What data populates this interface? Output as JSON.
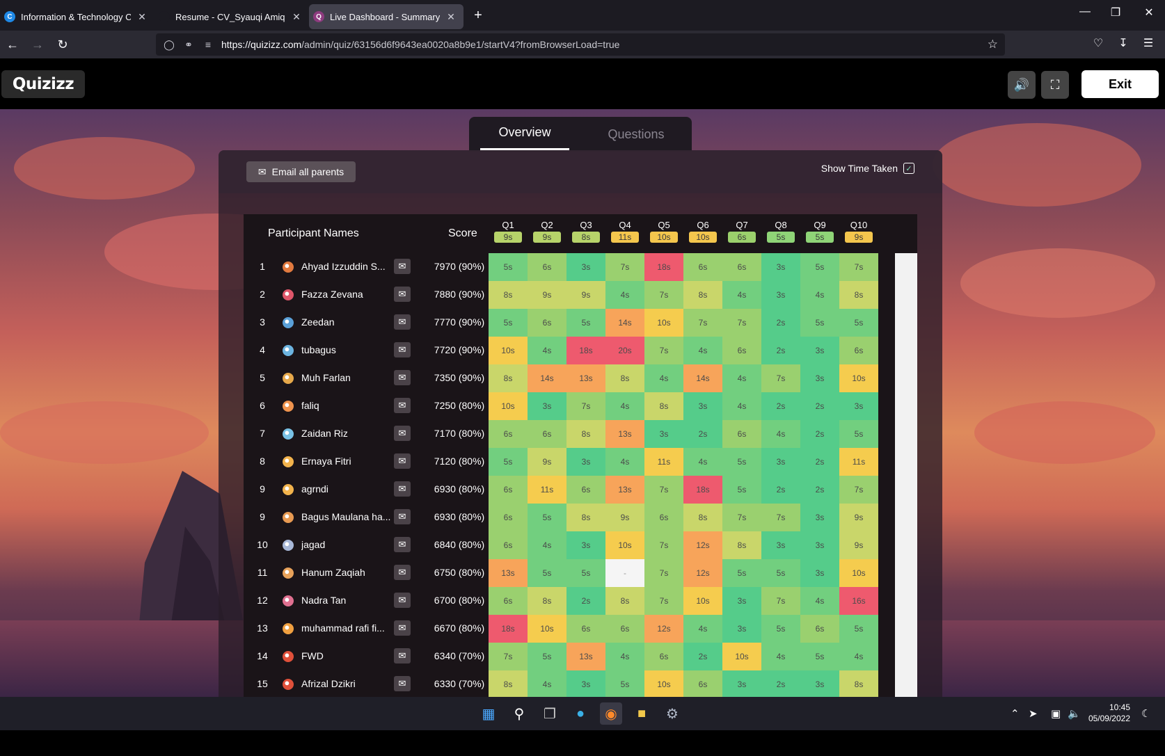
{
  "browser": {
    "tabs": [
      {
        "label": "Information & Technology Chal",
        "favicon": "C",
        "favicon_color": "#1e88e5",
        "active": false
      },
      {
        "label": "Resume - CV_Syauqi Amiq.pdf",
        "favicon": "",
        "favicon_color": "#1c1b22",
        "active": false
      },
      {
        "label": "Live Dashboard - Summary",
        "favicon": "Q",
        "favicon_color": "#8e3b7f",
        "active": true
      }
    ],
    "new_tab": "+",
    "url_domain": "https://quizizz.com",
    "url_path": "/admin/quiz/63156d6f9643ea0020a8b9e1/startV4?fromBrowserLoad=true"
  },
  "header": {
    "logo": "Quizizz",
    "exit_label": "Exit"
  },
  "view_tabs": {
    "overview": "Overview",
    "questions": "Questions"
  },
  "toolbar": {
    "email_all": "Email all parents",
    "show_time": "Show Time Taken",
    "show_time_checked": true
  },
  "table": {
    "col_names": "Participant Names",
    "col_score": "Score",
    "questions": [
      {
        "label": "Q1",
        "avg": "9s",
        "color": "#b7d36a"
      },
      {
        "label": "Q2",
        "avg": "9s",
        "color": "#b7d36a"
      },
      {
        "label": "Q3",
        "avg": "8s",
        "color": "#b7d36a"
      },
      {
        "label": "Q4",
        "avg": "11s",
        "color": "#f4c64d"
      },
      {
        "label": "Q5",
        "avg": "10s",
        "color": "#f4c64d"
      },
      {
        "label": "Q6",
        "avg": "10s",
        "color": "#f4c64d"
      },
      {
        "label": "Q7",
        "avg": "6s",
        "color": "#9bd06c"
      },
      {
        "label": "Q8",
        "avg": "5s",
        "color": "#8fd477"
      },
      {
        "label": "Q9",
        "avg": "5s",
        "color": "#8fd477"
      },
      {
        "label": "Q10",
        "avg": "9s",
        "color": "#f4c64d"
      }
    ],
    "rows": [
      {
        "rank": "1",
        "name": "Ahyad Izzuddin S...",
        "score": "7970 (90%)",
        "avatar": "#e27a3f",
        "times": [
          "5s",
          "6s",
          "3s",
          "7s",
          "18s",
          "6s",
          "6s",
          "3s",
          "5s",
          "7s"
        ]
      },
      {
        "rank": "2",
        "name": "Fazza Zevana",
        "score": "7880 (90%)",
        "avatar": "#e0566a",
        "times": [
          "8s",
          "9s",
          "9s",
          "4s",
          "7s",
          "8s",
          "4s",
          "3s",
          "4s",
          "8s"
        ]
      },
      {
        "rank": "3",
        "name": "Zeedan",
        "score": "7770 (90%)",
        "avatar": "#5aa0d8",
        "times": [
          "5s",
          "6s",
          "5s",
          "14s",
          "10s",
          "7s",
          "7s",
          "2s",
          "5s",
          "5s"
        ]
      },
      {
        "rank": "4",
        "name": "tubagus",
        "score": "7720 (90%)",
        "avatar": "#6cb4e0",
        "times": [
          "10s",
          "4s",
          "18s",
          "20s",
          "7s",
          "4s",
          "6s",
          "2s",
          "3s",
          "6s"
        ]
      },
      {
        "rank": "5",
        "name": "Muh Farlan",
        "score": "7350 (90%)",
        "avatar": "#e6a84a",
        "times": [
          "8s",
          "14s",
          "13s",
          "8s",
          "4s",
          "14s",
          "4s",
          "7s",
          "3s",
          "10s"
        ]
      },
      {
        "rank": "6",
        "name": "faliq",
        "score": "7250 (80%)",
        "avatar": "#f0944e",
        "times": [
          "10s",
          "3s",
          "7s",
          "4s",
          "8s",
          "3s",
          "4s",
          "2s",
          "2s",
          "3s"
        ]
      },
      {
        "rank": "7",
        "name": "Zaidan Riz",
        "score": "7170 (80%)",
        "avatar": "#79c2e6",
        "times": [
          "6s",
          "6s",
          "8s",
          "13s",
          "3s",
          "2s",
          "6s",
          "4s",
          "2s",
          "5s"
        ]
      },
      {
        "rank": "8",
        "name": "Ernaya Fitri",
        "score": "7120 (80%)",
        "avatar": "#f2b34c",
        "times": [
          "5s",
          "9s",
          "3s",
          "4s",
          "11s",
          "4s",
          "5s",
          "3s",
          "2s",
          "11s"
        ]
      },
      {
        "rank": "9",
        "name": "agrndi",
        "score": "6930 (80%)",
        "avatar": "#f2b34c",
        "times": [
          "6s",
          "11s",
          "6s",
          "13s",
          "7s",
          "18s",
          "5s",
          "2s",
          "2s",
          "7s"
        ]
      },
      {
        "rank": "9",
        "name": "Bagus Maulana ha...",
        "score": "6930 (80%)",
        "avatar": "#e89a52",
        "times": [
          "6s",
          "5s",
          "8s",
          "9s",
          "6s",
          "8s",
          "7s",
          "7s",
          "3s",
          "9s"
        ]
      },
      {
        "rank": "10",
        "name": "jagad",
        "score": "6840 (80%)",
        "avatar": "#a8b8d8",
        "times": [
          "6s",
          "4s",
          "3s",
          "10s",
          "7s",
          "12s",
          "8s",
          "3s",
          "3s",
          "9s"
        ]
      },
      {
        "rank": "11",
        "name": "Hanum Zaqiah",
        "score": "6750 (80%)",
        "avatar": "#e8a25a",
        "times": [
          "13s",
          "5s",
          "5s",
          "-",
          "7s",
          "12s",
          "5s",
          "5s",
          "3s",
          "10s"
        ]
      },
      {
        "rank": "12",
        "name": "Nadra Tan",
        "score": "6700 (80%)",
        "avatar": "#e07090",
        "times": [
          "6s",
          "8s",
          "2s",
          "8s",
          "7s",
          "10s",
          "3s",
          "7s",
          "4s",
          "16s"
        ]
      },
      {
        "rank": "13",
        "name": "muhammad rafi fi...",
        "score": "6670 (80%)",
        "avatar": "#f0a040",
        "times": [
          "18s",
          "10s",
          "6s",
          "6s",
          "12s",
          "4s",
          "3s",
          "5s",
          "6s",
          "5s"
        ]
      },
      {
        "rank": "14",
        "name": "FWD",
        "score": "6340 (70%)",
        "avatar": "#e0503a",
        "times": [
          "7s",
          "5s",
          "13s",
          "4s",
          "6s",
          "2s",
          "10s",
          "4s",
          "5s",
          "4s"
        ]
      },
      {
        "rank": "15",
        "name": "Afrizal Dzikri",
        "score": "6330 (70%)",
        "avatar": "#e0503a",
        "times": [
          "8s",
          "4s",
          "3s",
          "5s",
          "10s",
          "6s",
          "3s",
          "2s",
          "3s",
          "8s"
        ]
      }
    ]
  },
  "taskbar": {
    "time": "10:45",
    "date": "05/09/2022"
  },
  "colors": {
    "fast": "#55cc8a",
    "medium_fast": "#9ad06f",
    "medium": "#c9d66a",
    "slow": "#f5cc4e",
    "slower": "#f7a45a",
    "slowest": "#ee5a6e",
    "missing": "#f5f5f5"
  }
}
